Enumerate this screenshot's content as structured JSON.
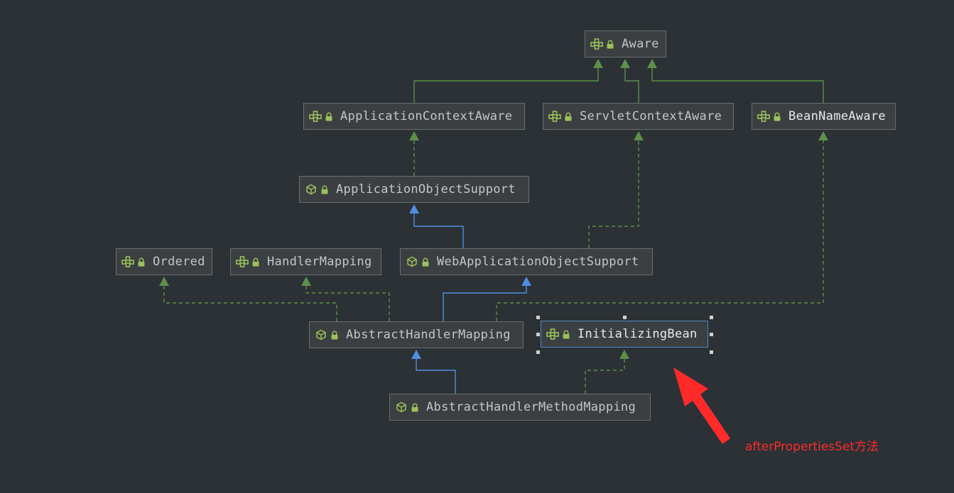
{
  "diagram": {
    "colors": {
      "interface_edge": "#5e8f4b",
      "class_edge": "#4f8fe0",
      "annotation": "#ff2a2a"
    },
    "nodes": {
      "aware": {
        "label": "Aware",
        "kind": "interface",
        "icon": "interface-icon"
      },
      "application_context_aware": {
        "label": "ApplicationContextAware",
        "kind": "interface",
        "icon": "interface-icon"
      },
      "servlet_context_aware": {
        "label": "ServletContextAware",
        "kind": "interface",
        "icon": "interface-icon"
      },
      "bean_name_aware": {
        "label": "BeanNameAware",
        "kind": "interface",
        "icon": "interface-icon"
      },
      "application_object_support": {
        "label": "ApplicationObjectSupport",
        "kind": "abstract-class",
        "icon": "abstract-class-icon"
      },
      "ordered": {
        "label": "Ordered",
        "kind": "interface",
        "icon": "interface-icon"
      },
      "handler_mapping": {
        "label": "HandlerMapping",
        "kind": "interface",
        "icon": "interface-icon"
      },
      "web_application_object_support": {
        "label": "WebApplicationObjectSupport",
        "kind": "abstract-class",
        "icon": "abstract-class-icon"
      },
      "abstract_handler_mapping": {
        "label": "AbstractHandlerMapping",
        "kind": "abstract-class",
        "icon": "abstract-class-icon"
      },
      "initializing_bean": {
        "label": "InitializingBean",
        "kind": "interface",
        "icon": "interface-icon",
        "selected": true
      },
      "abstract_handler_method_mapping": {
        "label": "AbstractHandlerMethodMapping",
        "kind": "abstract-class",
        "icon": "abstract-class-icon"
      }
    },
    "edges": [
      {
        "from": "ApplicationContextAware",
        "to": "Aware",
        "type": "extends-interface"
      },
      {
        "from": "ServletContextAware",
        "to": "Aware",
        "type": "extends-interface"
      },
      {
        "from": "BeanNameAware",
        "to": "Aware",
        "type": "extends-interface"
      },
      {
        "from": "ApplicationObjectSupport",
        "to": "ApplicationContextAware",
        "type": "implements"
      },
      {
        "from": "WebApplicationObjectSupport",
        "to": "ApplicationObjectSupport",
        "type": "extends"
      },
      {
        "from": "WebApplicationObjectSupport",
        "to": "ServletContextAware",
        "type": "implements"
      },
      {
        "from": "AbstractHandlerMapping",
        "to": "Ordered",
        "type": "implements"
      },
      {
        "from": "AbstractHandlerMapping",
        "to": "HandlerMapping",
        "type": "implements"
      },
      {
        "from": "AbstractHandlerMapping",
        "to": "WebApplicationObjectSupport",
        "type": "extends"
      },
      {
        "from": "AbstractHandlerMapping",
        "to": "BeanNameAware",
        "type": "implements"
      },
      {
        "from": "AbstractHandlerMethodMapping",
        "to": "AbstractHandlerMapping",
        "type": "extends"
      },
      {
        "from": "AbstractHandlerMethodMapping",
        "to": "InitializingBean",
        "type": "implements"
      }
    ],
    "annotation": {
      "text": "afterPropertiesSet方法",
      "points_to": "InitializingBean"
    }
  }
}
